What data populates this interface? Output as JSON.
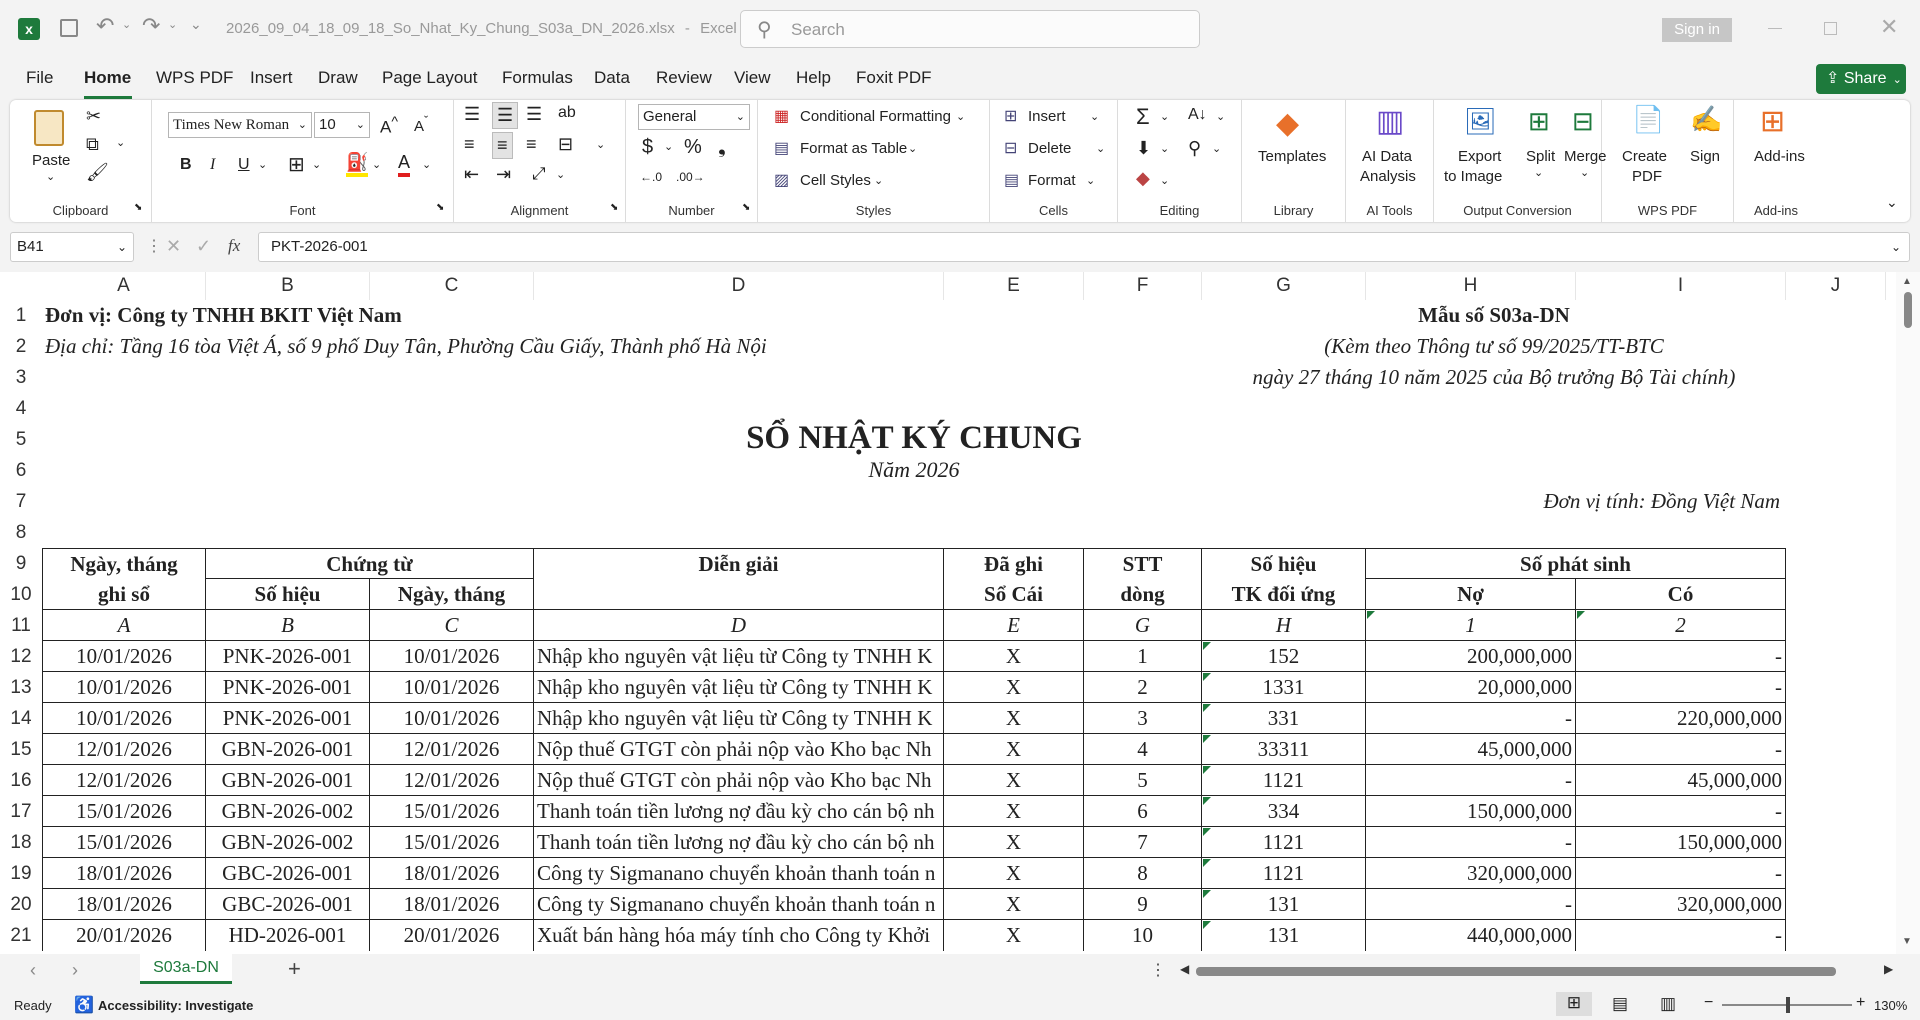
{
  "titlebar": {
    "filename": "2026_09_04_18_09_18_So_Nhat_Ky_Chung_S03a_DN_2026.xlsx",
    "app": "Excel",
    "separator": "-",
    "search_placeholder": "Search",
    "signin": "Sign in"
  },
  "menu": {
    "tabs": [
      "File",
      "Home",
      "WPS PDF",
      "Insert",
      "Draw",
      "Page Layout",
      "Formulas",
      "Data",
      "Review",
      "View",
      "Help",
      "Foxit PDF"
    ],
    "share": "Share"
  },
  "ribbon": {
    "clipboard": {
      "label": "Clipboard",
      "paste": "Paste"
    },
    "font": {
      "label": "Font",
      "name": "Times New Roman",
      "size": "10",
      "bold": "B",
      "italic": "I",
      "underline": "U"
    },
    "alignment": {
      "label": "Alignment"
    },
    "number": {
      "label": "Number",
      "format": "General"
    },
    "styles": {
      "label": "Styles",
      "conditional": "Conditional Formatting",
      "table": "Format as Table",
      "cell": "Cell Styles"
    },
    "cells": {
      "label": "Cells",
      "insert": "Insert",
      "delete": "Delete",
      "format": "Format"
    },
    "editing": {
      "label": "Editing"
    },
    "library": {
      "label": "Library",
      "templates": "Templates"
    },
    "aitools": {
      "label": "AI Tools",
      "analysis_l1": "AI Data",
      "analysis_l2": "Analysis"
    },
    "output": {
      "label": "Output Conversion",
      "export_l1": "Export",
      "export_l2": "to Image",
      "split": "Split",
      "merge": "Merge"
    },
    "wpspdf": {
      "label": "WPS PDF",
      "create_l1": "Create",
      "create_l2": "PDF",
      "sign": "Sign"
    },
    "addins": {
      "label": "Add-ins",
      "addins": "Add-ins"
    }
  },
  "formula": {
    "namebox": "B41",
    "fx": "fx",
    "value": "PKT-2026-001"
  },
  "columns": [
    "A",
    "B",
    "C",
    "D",
    "E",
    "F",
    "G",
    "H",
    "I",
    "J"
  ],
  "rows": [
    "1",
    "2",
    "3",
    "4",
    "5",
    "6",
    "7",
    "8",
    "9",
    "10",
    "11",
    "12",
    "13",
    "14",
    "15",
    "16",
    "17",
    "18",
    "19",
    "20",
    "21"
  ],
  "sheet": {
    "unit": "Đơn vị: Công ty TNHH BKIT Việt Nam",
    "address": "Địa chỉ: Tầng 16 tòa Việt Á, số 9 phố Duy Tân, Phường Cầu Giấy, Thành phố Hà Nội",
    "form": "Mẫu số S03a-DN",
    "circular": "(Kèm theo Thông tư số 99/2025/TT-BTC",
    "circular_date": "ngày 27 tháng 10 năm 2025 của Bộ trưởng Bộ Tài chính)",
    "title": "SỔ NHẬT KÝ CHUNG",
    "year": "Năm 2026",
    "currency": "Đơn vị tính: Đồng Việt Nam",
    "headers": {
      "date_l1": "Ngày, tháng",
      "date_l2": "ghi sổ",
      "voucher": "Chứng từ",
      "voucher_no": "Số hiệu",
      "voucher_date": "Ngày, tháng",
      "desc": "Diễn giải",
      "posted_l1": "Đã ghi",
      "posted_l2": "Sổ Cái",
      "line_l1": "STT",
      "line_l2": "dòng",
      "acc_l1": "Số hiệu",
      "acc_l2": "TK đối ứng",
      "amount": "Số phát sinh",
      "debit": "Nợ",
      "credit": "Có"
    },
    "codes": [
      "A",
      "B",
      "C",
      "D",
      "E",
      "G",
      "H",
      "1",
      "2"
    ],
    "entries": [
      {
        "date": "10/01/2026",
        "no": "PNK-2026-001",
        "vdate": "10/01/2026",
        "desc": "Nhập kho nguyên vật liệu từ Công ty TNHH K",
        "posted": "X",
        "line": "1",
        "acc": "152",
        "debit": "200,000,000",
        "credit": "-"
      },
      {
        "date": "10/01/2026",
        "no": "PNK-2026-001",
        "vdate": "10/01/2026",
        "desc": "Nhập kho nguyên vật liệu từ Công ty TNHH K",
        "posted": "X",
        "line": "2",
        "acc": "1331",
        "debit": "20,000,000",
        "credit": "-"
      },
      {
        "date": "10/01/2026",
        "no": "PNK-2026-001",
        "vdate": "10/01/2026",
        "desc": "Nhập kho nguyên vật liệu từ Công ty TNHH K",
        "posted": "X",
        "line": "3",
        "acc": "331",
        "debit": "-",
        "credit": "220,000,000"
      },
      {
        "date": "12/01/2026",
        "no": "GBN-2026-001",
        "vdate": "12/01/2026",
        "desc": "Nộp thuế GTGT còn phải nộp vào Kho bạc Nh",
        "posted": "X",
        "line": "4",
        "acc": "33311",
        "debit": "45,000,000",
        "credit": "-"
      },
      {
        "date": "12/01/2026",
        "no": "GBN-2026-001",
        "vdate": "12/01/2026",
        "desc": "Nộp thuế GTGT còn phải nộp vào Kho bạc Nh",
        "posted": "X",
        "line": "5",
        "acc": "1121",
        "debit": "-",
        "credit": "45,000,000"
      },
      {
        "date": "15/01/2026",
        "no": "GBN-2026-002",
        "vdate": "15/01/2026",
        "desc": "Thanh toán tiền lương nợ đầu kỳ cho cán bộ nh",
        "posted": "X",
        "line": "6",
        "acc": "334",
        "debit": "150,000,000",
        "credit": "-"
      },
      {
        "date": "15/01/2026",
        "no": "GBN-2026-002",
        "vdate": "15/01/2026",
        "desc": "Thanh toán tiền lương nợ đầu kỳ cho cán bộ nh",
        "posted": "X",
        "line": "7",
        "acc": "1121",
        "debit": "-",
        "credit": "150,000,000"
      },
      {
        "date": "18/01/2026",
        "no": "GBC-2026-001",
        "vdate": "18/01/2026",
        "desc": "Công ty Sigmanano chuyển khoản thanh toán n",
        "posted": "X",
        "line": "8",
        "acc": "1121",
        "debit": "320,000,000",
        "credit": "-"
      },
      {
        "date": "18/01/2026",
        "no": "GBC-2026-001",
        "vdate": "18/01/2026",
        "desc": "Công ty Sigmanano chuyển khoản thanh toán n",
        "posted": "X",
        "line": "9",
        "acc": "131",
        "debit": "-",
        "credit": "320,000,000"
      },
      {
        "date": "20/01/2026",
        "no": "HD-2026-001",
        "vdate": "20/01/2026",
        "desc": "Xuất bán hàng hóa máy tính cho Công ty Khởi",
        "posted": "X",
        "line": "10",
        "acc": "131",
        "debit": "440,000,000",
        "credit": "-"
      }
    ]
  },
  "tabs": {
    "sheet": "S03a-DN",
    "add": "+"
  },
  "status": {
    "ready": "Ready",
    "accessibility": "Accessibility: Investigate",
    "zoom": "130%",
    "minus": "−",
    "plus": "+"
  }
}
